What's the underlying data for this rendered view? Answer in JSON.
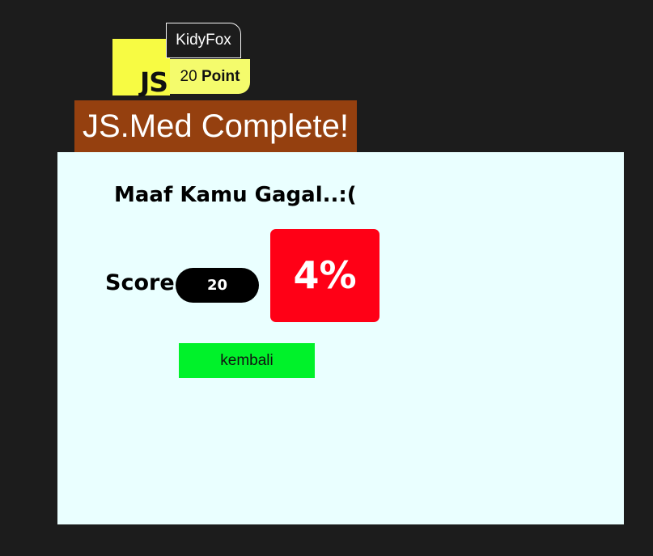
{
  "header": {
    "logo_text": "JS",
    "username": "KidyFox",
    "points_value": "20",
    "points_label": "Point",
    "title": "JS.Med Complete!"
  },
  "result": {
    "message": "Maaf Kamu Gagal..:(",
    "score_label": "Score",
    "score_value": "20",
    "percent": "4%",
    "back_button_label": "kembali"
  },
  "colors": {
    "logo_bg": "#f7fb43",
    "points_bg": "#f4fb6c",
    "title_bg": "#95400f",
    "panel_bg": "#eaffff",
    "percent_bg": "#ff0016",
    "button_bg": "#00f22a"
  }
}
